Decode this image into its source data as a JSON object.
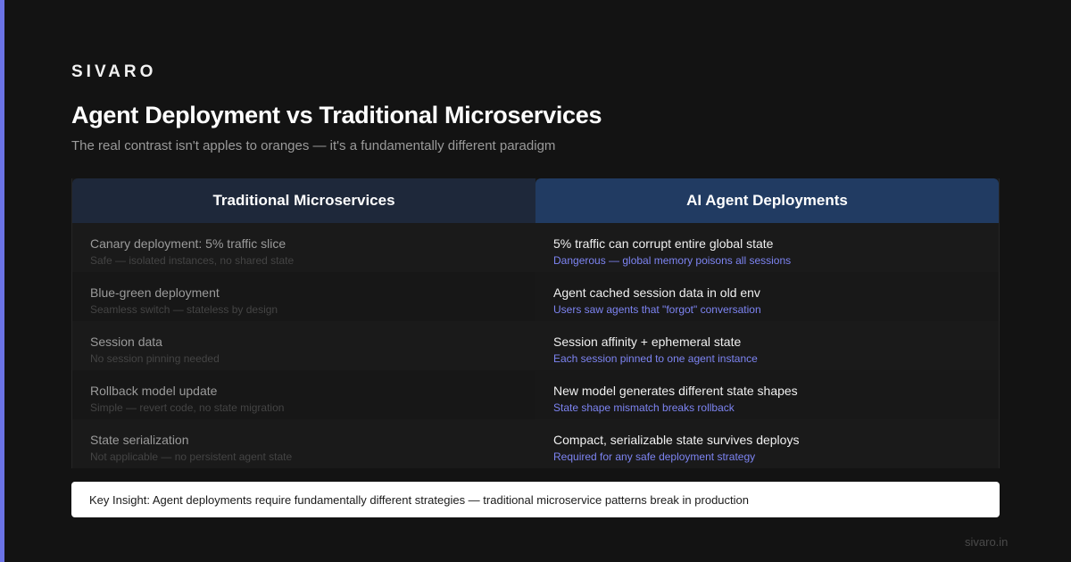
{
  "brand": "SIVARO",
  "title": "Agent Deployment vs Traditional Microservices",
  "subtitle": "The real contrast isn't apples to oranges — it's a fundamentally different paradigm",
  "columns": [
    {
      "header": "Traditional Microservices",
      "rows": [
        {
          "main": "Canary deployment: 5% traffic slice",
          "sub": "Safe — isolated instances, no shared state"
        },
        {
          "main": "Blue-green deployment",
          "sub": "Seamless switch — stateless by design"
        },
        {
          "main": "Session data",
          "sub": "No session pinning needed"
        },
        {
          "main": "Rollback model update",
          "sub": "Simple — revert code, no state migration"
        },
        {
          "main": "State serialization",
          "sub": "Not applicable — no persistent agent state"
        }
      ]
    },
    {
      "header": "AI Agent Deployments",
      "rows": [
        {
          "main": "5% traffic can corrupt entire global state",
          "sub": "Dangerous — global memory poisons all sessions"
        },
        {
          "main": "Agent cached session data in old env",
          "sub": "Users saw agents that \"forgot\" conversation"
        },
        {
          "main": "Session affinity + ephemeral state",
          "sub": "Each session pinned to one agent instance"
        },
        {
          "main": "New model generates different state shapes",
          "sub": "State shape mismatch breaks rollback"
        },
        {
          "main": "Compact, serializable state survives deploys",
          "sub": "Required for any safe deployment strategy"
        }
      ]
    }
  ],
  "insight": "Key Insight: Agent deployments require fundamentally different strategies — traditional microservice patterns break in production",
  "footer": "sivaro.in",
  "colors": {
    "accent": "#6b73e6",
    "left_header_bg": "#1e283a",
    "right_header_bg": "#213b62",
    "right_sub_text": "#7d84f2"
  }
}
